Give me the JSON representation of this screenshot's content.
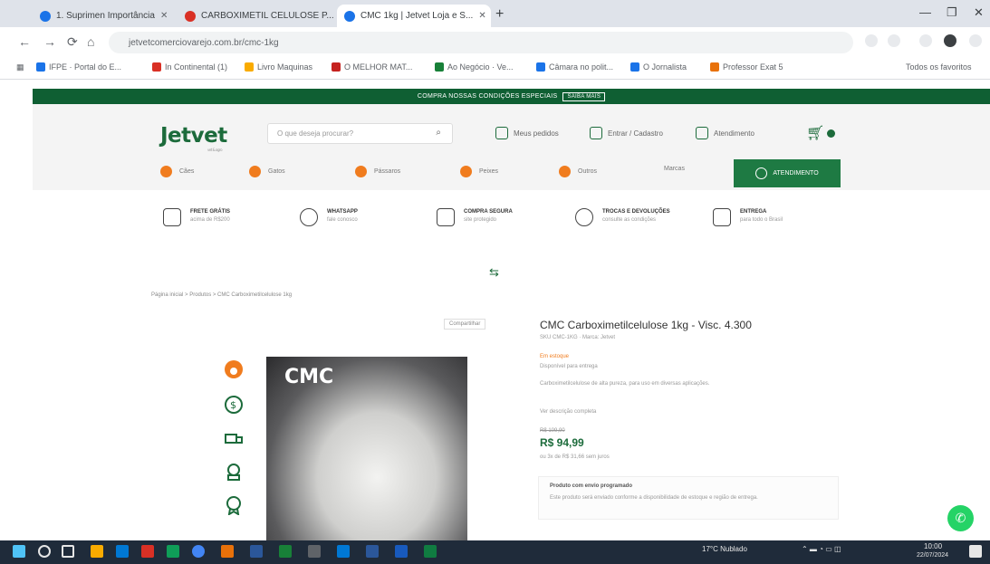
{
  "browser": {
    "tabs": [
      {
        "label": "1. Suprimen Importância",
        "color": "#1a73e8"
      },
      {
        "label": "CARBOXIMETIL CELULOSE P...",
        "color": "#d93025"
      },
      {
        "label": "CMC 1kg | Jetvet Loja e S...",
        "color": "#1a73e8"
      }
    ],
    "new_tab": "+",
    "address": "jetvetcomerciovarejo.com.br/cmc-1kg",
    "bookmarks": [
      {
        "label": "IFPE · Portal do E...",
        "color": "#1a73e8"
      },
      {
        "label": "In Continental (1)",
        "color": "#d93025"
      },
      {
        "label": "Livro Maquinas",
        "color": "#f9ab00"
      },
      {
        "label": "O MELHOR MAT...",
        "color": "#c5221f"
      },
      {
        "label": "Ao Negócio · Ve...",
        "color": "#188038"
      },
      {
        "label": "Câmara no polit...",
        "color": "#1a73e8"
      },
      {
        "label": "O Jornalista",
        "color": "#1a73e8"
      },
      {
        "label": "Professor Exat 5",
        "color": "#e8710a"
      }
    ],
    "other_bookmarks": "Todos os favoritos"
  },
  "site": {
    "promo": "COMPRA NOSSAS CONDIÇÕES ESPECIAIS",
    "promo_btn": "SAIBA MAIS",
    "logo": "Jetvet",
    "logo_sub": "vet & agro",
    "search_placeholder": "O que deseja procurar?",
    "header_links": [
      "Meus pedidos",
      "Entrar / Cadastro",
      "Atendimento"
    ],
    "cart_count": "0",
    "categories": [
      "Cães",
      "Gatos",
      "Pássaros",
      "Peixes",
      "Outros",
      "Marcas"
    ],
    "atendimento_btn": "ATENDIMENTO",
    "benefits": [
      {
        "title": "FRETE GRÁTIS",
        "sub": "acima de R$200"
      },
      {
        "title": "WHATSAPP",
        "sub": "fale conosco"
      },
      {
        "title": "COMPRA SEGURA",
        "sub": "site protegido"
      },
      {
        "title": "TROCAS E DEVOLUÇÕES",
        "sub": "consulte as condições"
      },
      {
        "title": "ENTREGA",
        "sub": "para todo o Brasil"
      }
    ],
    "breadcrumb": "Página inicial > Produtos > CMC Carboximetilcelulose 1kg",
    "share": "Compartilhar",
    "image_label": "CMC"
  },
  "product": {
    "title": "CMC Carboximetilcelulose 1kg - Visc. 4.300",
    "sku": "SKU CMC-1KG · Marca: Jetvet",
    "stock": "Em estoque",
    "availability": "Disponível para entrega",
    "desc": "Carboximetilcelulose de alta pureza, para uso em diversas aplicações.",
    "more": "Ver descrição completa",
    "old_price": "R$ 109,90",
    "price": "R$ 94,99",
    "installments": "ou 3x de R$ 31,66 sem juros",
    "shipping_title": "Produto com envio programado",
    "shipping_text": "Este produto será enviado conforme a disponibilidade de estoque e região de entrega."
  },
  "taskbar": {
    "weather": "17°C  Nublado",
    "time": "10:00",
    "date": "22/07/2024"
  }
}
